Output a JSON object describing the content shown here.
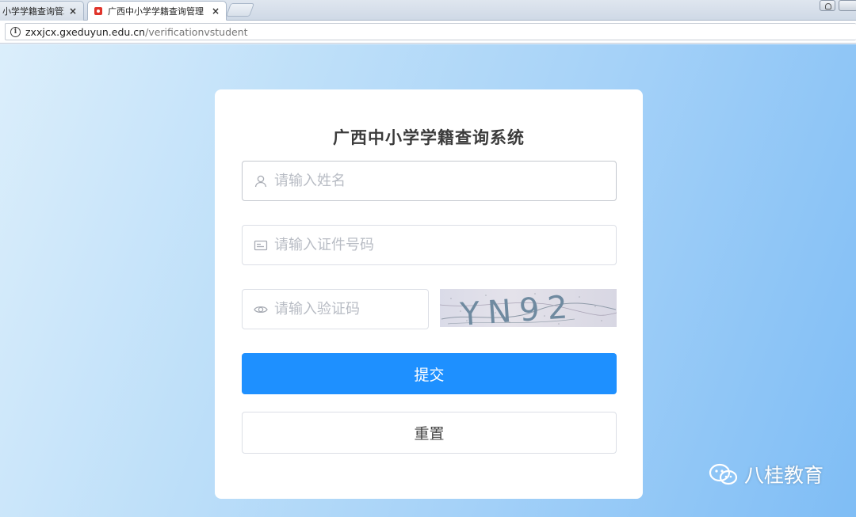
{
  "browser": {
    "tabs": [
      {
        "label": "小学学籍查询管理",
        "close": "×"
      },
      {
        "label": "广西中小学学籍查询管理",
        "close": "×"
      }
    ],
    "url_host": "zxxjcx.gxeduyun.edu.cn",
    "url_path": "/verificationvstudent"
  },
  "form": {
    "title": "广西中小学学籍查询系统",
    "name_placeholder": "请输入姓名",
    "id_placeholder": "请输入证件号码",
    "captcha_placeholder": "请输入验证码",
    "captcha_text": "YN92",
    "submit_label": "提交",
    "reset_label": "重置"
  },
  "watermark": {
    "text": "八桂教育"
  },
  "icons": {
    "name_field": "user-icon",
    "id_field": "id-card-icon",
    "captcha_field": "eye-icon",
    "watermark": "wechat-icon"
  },
  "colors": {
    "primary": "#1e90ff",
    "card": "#ffffff",
    "placeholder": "#b8bcc4"
  }
}
